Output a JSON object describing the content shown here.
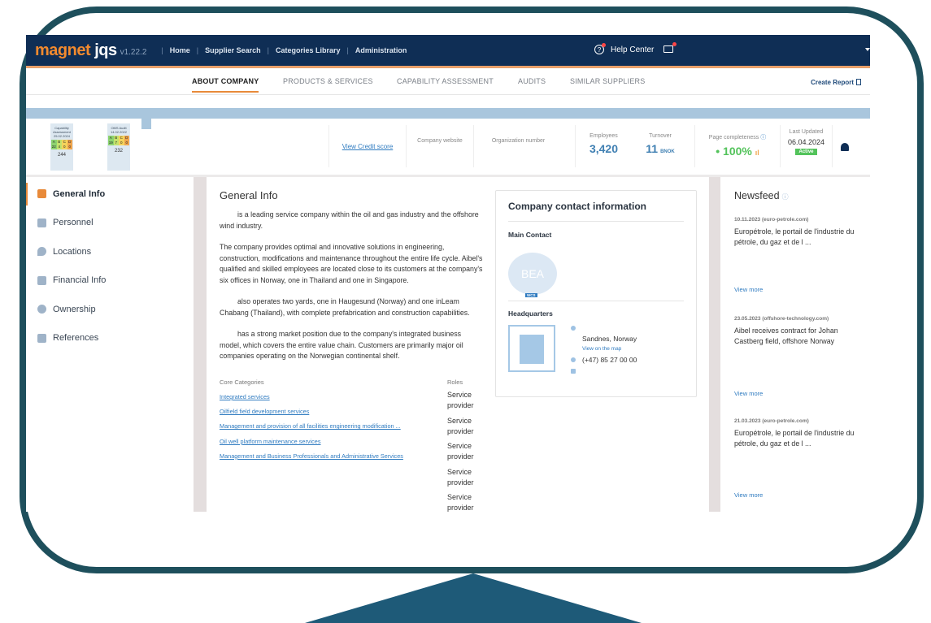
{
  "app": {
    "logo_a": "magnet",
    "logo_b": "jqs",
    "version": "v1.22.2"
  },
  "nav": {
    "items": [
      "Home",
      "Supplier Search",
      "Categories Library",
      "Administration"
    ]
  },
  "header": {
    "help": "Help Center"
  },
  "tabs": {
    "items": [
      "ABOUT COMPANY",
      "PRODUCTS & SERVICES",
      "CAPABILITY ASSESSMENT",
      "AUDITS",
      "SIMILAR SUPPLIERS"
    ],
    "create_report": "Create Report"
  },
  "badges": [
    {
      "line1": "Capability",
      "line2": "Assessment",
      "date": "25.02.2024",
      "letters": [
        "A",
        "B",
        "C",
        "D"
      ],
      "scores": [
        "22",
        "4",
        "0",
        "0"
      ],
      "total": "244"
    },
    {
      "line1": "",
      "line2": "OMS Audit",
      "date": "14.02.2022",
      "letters": [
        "A",
        "B",
        "C",
        "D"
      ],
      "scores": [
        "19",
        "7",
        "0",
        "0"
      ],
      "total": "232"
    }
  ],
  "stats": {
    "credit": "View Credit score",
    "website": "Company website",
    "orgnum": "Organization number",
    "employees_label": "Employees",
    "employees": "3,420",
    "turnover_label": "Turnover",
    "turnover": "11",
    "turnover_unit": "BNOK",
    "completeness_label": "Page completeness",
    "completeness": "100%",
    "updated_label": "Last Updated",
    "updated": "06.04.2024",
    "status": "Active"
  },
  "sidebar": {
    "items": [
      "General Info",
      "Personnel",
      "Locations",
      "Financial Info",
      "Ownership",
      "References"
    ]
  },
  "general": {
    "title": "General Info",
    "p1": "is a leading service company within the oil and gas industry and the offshore wind industry.",
    "p2": "The company provides optimal and innovative solutions in engineering, construction, modifications and maintenance throughout the entire life cycle. Aibel's qualified and skilled employees are located close to its customers at the company's six offices in Norway, one in Thailand and one in Singapore.",
    "p3": "also operates two yards, one in Haugesund (Norway) and one inLeam Chabang (Thailand), with complete prefabrication and construction capabilities.",
    "p4": "has a strong market position due to the company's integrated business model, which covers the entire value chain. Customers are primarily major oil companies operating on the Norwegian continental shelf."
  },
  "categories": {
    "head": "Core Categories",
    "roles_head": "Roles",
    "links": [
      "Integrated services",
      "Oilfield field development services",
      "Management and provision of all facilities engineering modification ...",
      "Oil well platform maintenance services",
      "Management and Business Professionals and Administrative Services"
    ],
    "roles": [
      "Service provider",
      "Service provider",
      "Service provider",
      "Service provider",
      "Service provider"
    ]
  },
  "contact": {
    "title": "Company contact information",
    "main": "Main Contact",
    "initials": "BEA",
    "tag": "WCS",
    "hq": "Headquarters",
    "city": "Sandnes, Norway",
    "map": "View on the map",
    "phone": "(+47) 85 27 00 00"
  },
  "news": {
    "title": "Newsfeed",
    "items": [
      {
        "date": "10.11.2023 (euro-petrole.com)",
        "text": "Europétrole, le portail de l'industrie du pétrole, du gaz et de l ...",
        "more": "View more"
      },
      {
        "date": "23.05.2023 (offshore-technology.com)",
        "text": "Aibel receives contract for Johan Castberg field, offshore Norway",
        "more": "View more"
      },
      {
        "date": "21.03.2023 (euro-petrole.com)",
        "text": "Europétrole, le portail de l'industrie du pétrole, du gaz et de l ...",
        "more": "View more"
      }
    ]
  }
}
